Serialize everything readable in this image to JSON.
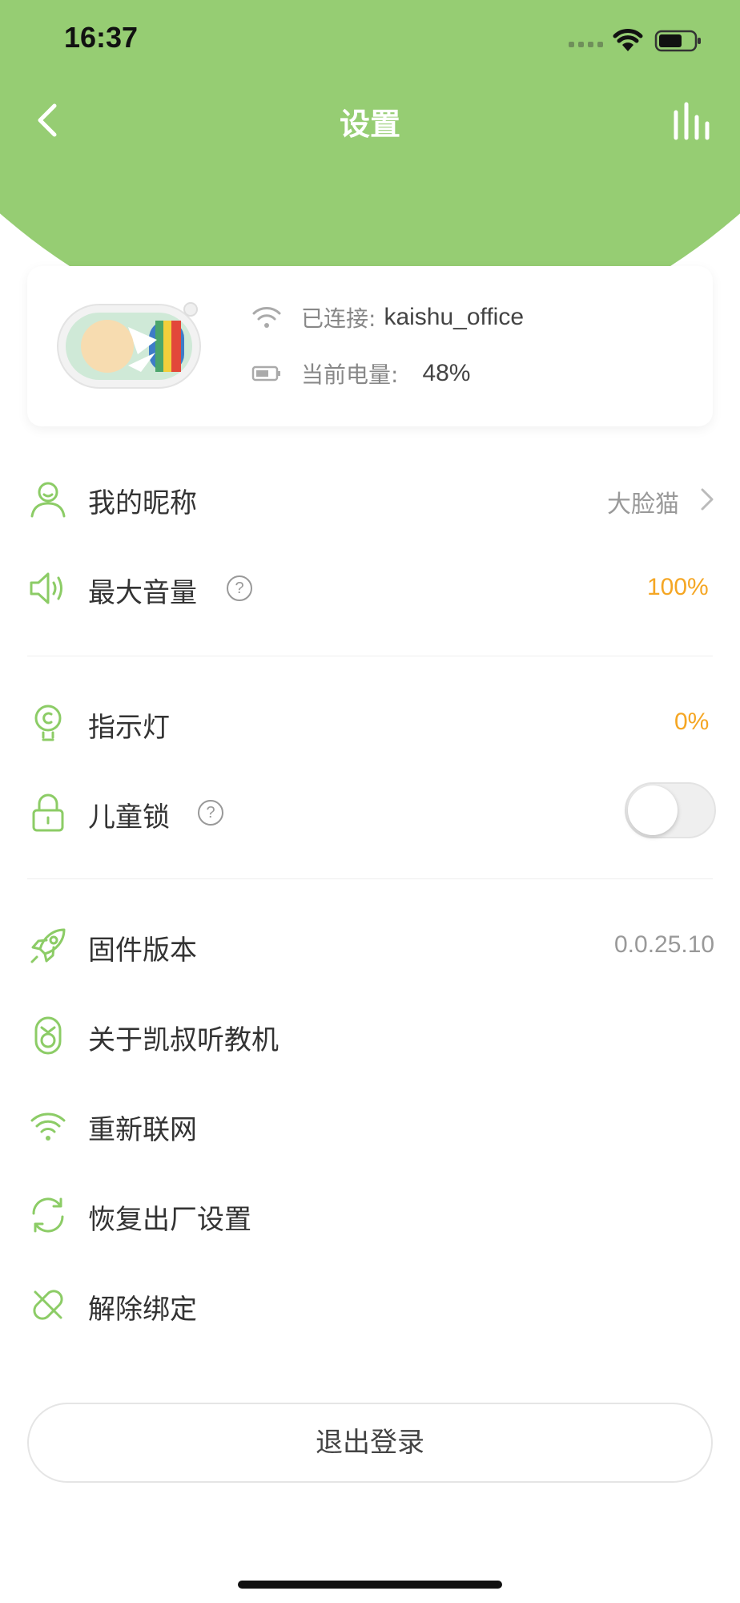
{
  "status_bar": {
    "time": "16:37"
  },
  "header": {
    "title": "设置"
  },
  "device": {
    "connection_label": "已连接:",
    "connection_value": "kaishu_office",
    "battery_label": "当前电量:",
    "battery_value": "48%"
  },
  "settings": {
    "nickname": {
      "label": "我的昵称",
      "value": "大脸猫"
    },
    "max_volume": {
      "label": "最大音量",
      "help": "?",
      "value": "100%"
    },
    "indicator_light": {
      "label": "指示灯",
      "value": "0%"
    },
    "child_lock": {
      "label": "儿童锁",
      "help": "?",
      "enabled": false
    },
    "firmware": {
      "label": "固件版本",
      "value": "0.0.25.10"
    },
    "about": {
      "label": "关于凯叔听教机"
    },
    "reconnect": {
      "label": "重新联网"
    },
    "factory_reset": {
      "label": "恢复出厂设置"
    },
    "unbind": {
      "label": "解除绑定"
    }
  },
  "logout": {
    "label": "退出登录"
  },
  "colors": {
    "header_green": "#96cd73",
    "icon_green": "#8ccc66",
    "accent_orange": "#f5a623",
    "muted_gray": "#999999"
  },
  "icons": {
    "back": "chevron-left-icon",
    "stats": "bar-chart-icon",
    "wifi": "wifi-icon",
    "battery": "battery-icon",
    "user": "user-icon",
    "speaker": "speaker-icon",
    "bulb": "bulb-icon",
    "lock": "lock-icon",
    "rocket": "rocket-icon",
    "device": "device-icon",
    "refresh": "refresh-icon",
    "unlink": "unlink-icon"
  }
}
